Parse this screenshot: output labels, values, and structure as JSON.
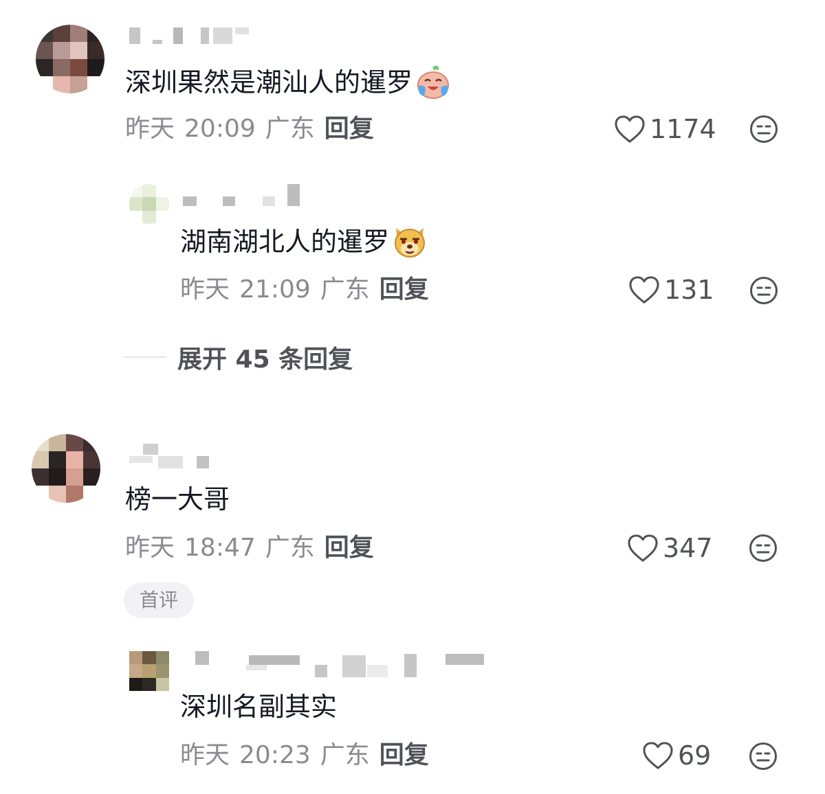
{
  "comments": [
    {
      "text": "深圳果然是潮汕人的暹罗",
      "emoji_icon": "crying-laughing-emoji",
      "date": "昨天",
      "time": "20:09",
      "location": "广东",
      "reply_label": "回复",
      "likes": "1174"
    },
    {
      "text": "湖南湖北人的暹罗",
      "emoji_icon": "smirking-dog-emoji",
      "date": "昨天",
      "time": "21:09",
      "location": "广东",
      "reply_label": "回复",
      "likes": "131"
    },
    {
      "text": "榜一大哥",
      "date": "昨天",
      "time": "18:47",
      "location": "广东",
      "reply_label": "回复",
      "likes": "347",
      "badge": "首评"
    },
    {
      "text": "深圳名副其实",
      "date": "昨天",
      "time": "20:23",
      "location": "广东",
      "reply_label": "回复",
      "likes": "69"
    }
  ],
  "expand_replies": "展开 45 条回复",
  "icons": {
    "like": "heart-outline-icon",
    "dislike": "neutral-face-icon"
  },
  "colors": {
    "text": "#161823",
    "meta": "#8a8b91",
    "accent": "#505259"
  }
}
